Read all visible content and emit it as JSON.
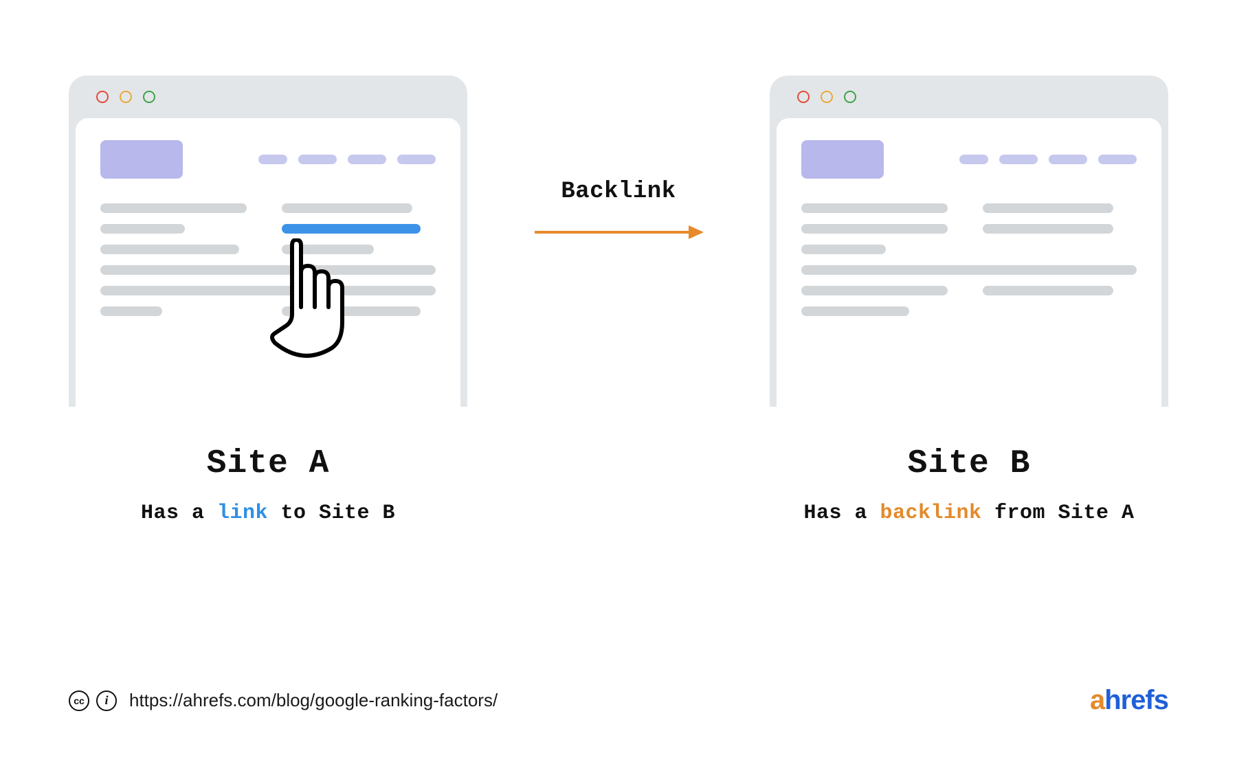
{
  "arrow_label": "Backlink",
  "site_a": {
    "title": "Site A",
    "sub_pre": "Has a ",
    "sub_hl": "link",
    "sub_post": " to Site B"
  },
  "site_b": {
    "title": "Site B",
    "sub_pre": "Has a ",
    "sub_hl": "backlink",
    "sub_post": " from Site A"
  },
  "footer": {
    "cc_label": "cc",
    "by_label": "i",
    "url": "https://ahrefs.com/blog/google-ranking-factors/",
    "brand_accent": "a",
    "brand_rest": "hrefs"
  },
  "colors": {
    "link_blue": "#3c92e6",
    "accent_orange": "#e38a2b",
    "brand_blue": "#1f5fd8"
  }
}
